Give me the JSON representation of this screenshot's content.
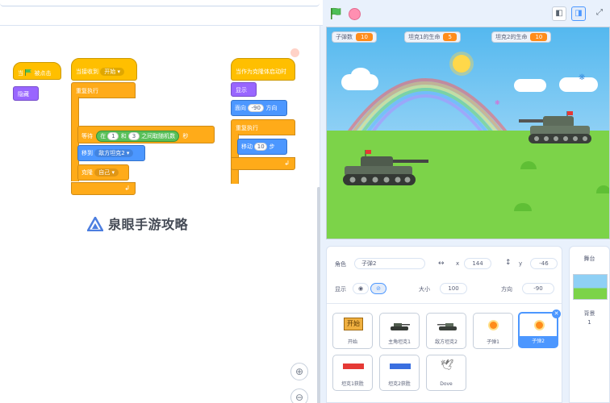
{
  "workspace": {
    "watermark": "泉眼手游攻略"
  },
  "scripts": {
    "script1": {
      "hat_prefix": "当",
      "hat_suffix": "被点击",
      "hide": "隐藏"
    },
    "script2": {
      "hat": "当接收到",
      "hat_msg": "开始",
      "forever": "重复执行",
      "wait": "等待",
      "random_in": "在",
      "random_min": "1",
      "random_and": "和",
      "random_max": "3",
      "random_between": "之间取随机数",
      "seconds": "秒",
      "goto": "移到",
      "goto_target": "敌方坦克2",
      "clone": "克隆",
      "clone_target": "自己"
    },
    "script3": {
      "hat": "当作为克隆体启动时",
      "show": "显示",
      "point": "面向",
      "point_val": "-90",
      "point_unit": "方向",
      "forever": "重复执行",
      "move": "移动",
      "move_val": "10",
      "move_unit": "步"
    }
  },
  "zoom": {
    "in": "⊕",
    "out": "⊖"
  },
  "stage": {
    "monitors": [
      {
        "label": "子弹数",
        "value": "10"
      },
      {
        "label": "坦克1的生命",
        "value": "5"
      },
      {
        "label": "坦克2的生命",
        "value": "10"
      }
    ]
  },
  "sprite_info": {
    "sprite_label": "角色",
    "sprite_name": "子弹2",
    "x_label": "x",
    "x_value": "144",
    "y_label": "y",
    "y_value": "-46",
    "show_label": "显示",
    "size_label": "大小",
    "size_value": "100",
    "direction_label": "方向",
    "direction_value": "-90"
  },
  "sprites": [
    {
      "name": "开始",
      "thumb": "开始"
    },
    {
      "name": "主角坦克1"
    },
    {
      "name": "敌方坦克2"
    },
    {
      "name": "子弹1"
    },
    {
      "name": "子弹2",
      "selected": true
    },
    {
      "name": "坦克1获胜"
    },
    {
      "name": "坦克2获胜"
    },
    {
      "name": "Dove"
    }
  ],
  "stage_selector": {
    "title": "舞台",
    "backdrop_label": "背景",
    "backdrop_count": "1"
  },
  "colors": {
    "accent": "#4c97ff",
    "events": "#ffbf00",
    "control": "#ffab19",
    "looks": "#9966ff",
    "motion": "#4c97ff",
    "operators": "#59c059",
    "monitor_value": "#ff8c1a"
  }
}
